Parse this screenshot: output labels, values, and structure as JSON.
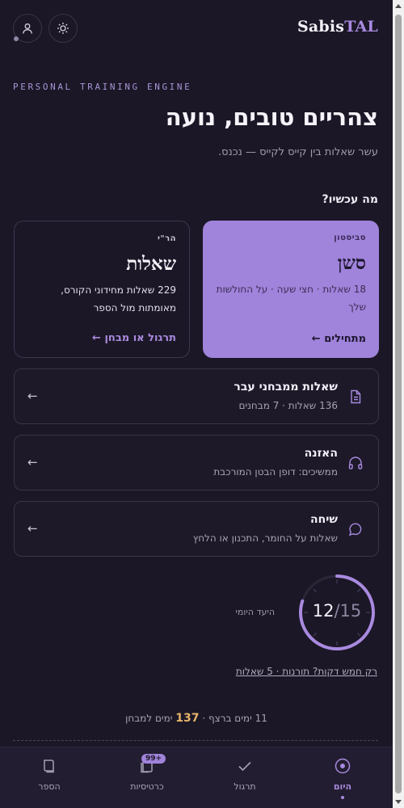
{
  "header": {
    "logo_main": "Sabis",
    "logo_accent": "TAL",
    "user_icon": "user-icon",
    "theme_icon": "sun-icon"
  },
  "hero": {
    "kicker": "PERSONAL TRAINING ENGINE",
    "greeting": "צהריים טובים, נועה",
    "subtitle": "עשר שאלות בין קייס לקייס — נכנס."
  },
  "section_label": "מה עכשיו?",
  "cards": {
    "primary": {
      "tag": "סביסטון",
      "title": "סשן",
      "desc": "18 שאלות · חצי שעה · על החולשות שלך",
      "cta": "מתחילים ←"
    },
    "secondary": {
      "tag": "הר\"י",
      "title": "שאלות",
      "desc": "229 שאלות מחידוני הקורס, מאומתות מול הספר",
      "cta": "תרגול או מבחן ←"
    }
  },
  "rows": [
    {
      "title": "שאלות ממבחני עבר",
      "sub": "136 שאלות · 7 מבחנים",
      "icon": "document-icon",
      "arrow": "←"
    },
    {
      "title": "האזנה",
      "sub": "ממשיכים: דופן הבטן המורכבת",
      "icon": "headphones-icon",
      "arrow": "←"
    },
    {
      "title": "שיחה",
      "sub": "שאלות על החומר, התכנון או הלחץ",
      "icon": "chat-bubble-icon",
      "arrow": "←"
    }
  ],
  "daily_goal": {
    "done": 12,
    "done_text": "12",
    "slash": "/",
    "target_text": "15",
    "progress": 0.8,
    "label": "היעד היומי",
    "accent_color": "#a98ae0"
  },
  "short_link": "רק חמש דקות? תורנות · 5 שאלות",
  "streak": {
    "prefix": "11 ימים ברצף ·",
    "days": "137",
    "suffix": "ימים למבחן"
  },
  "nav": [
    {
      "label": "היום",
      "icon": "target-icon",
      "active": true
    },
    {
      "label": "תרגול",
      "icon": "checkmark-icon",
      "active": false
    },
    {
      "label": "כרטיסיות",
      "icon": "cards-icon",
      "active": false,
      "badge": "99+"
    },
    {
      "label": "הספר",
      "icon": "book-icon",
      "active": false
    }
  ]
}
